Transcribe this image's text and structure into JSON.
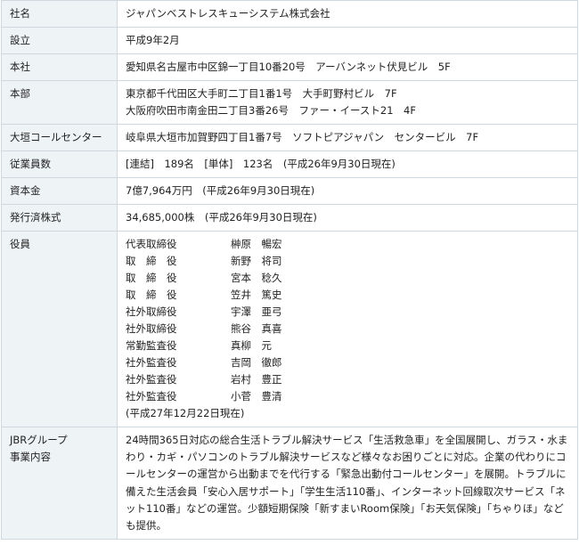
{
  "rows": {
    "company_name": {
      "label": "社名",
      "value": "ジャパンベストレスキューシステム株式会社"
    },
    "established": {
      "label": "設立",
      "value": "平成9年2月"
    },
    "head_office": {
      "label": "本社",
      "value": "愛知県名古屋市中区錦一丁目10番20号　アーバンネット伏見ビル　5F"
    },
    "headquarters": {
      "label": "本部",
      "line1": "東京都千代田区大手町二丁目1番1号　大手町野村ビル　7F",
      "line2": "大阪府吹田市南金田二丁目3番26号　ファー・イースト21　4F"
    },
    "call_center": {
      "label": "大垣コールセンター",
      "value": "岐阜県大垣市加賀野四丁目1番7号　ソフトピアジャパン　センタービル　7F"
    },
    "employees": {
      "label": "従業員数",
      "value": "[連結]　189名　[単体]　123名　(平成26年9月30日現在)"
    },
    "capital": {
      "label": "資本金",
      "value": "7億7,964万円　(平成26年9月30日現在)"
    },
    "shares": {
      "label": "発行済株式",
      "value": "34,685,000株　(平成26年9月30日現在)"
    },
    "officers": {
      "label": "役員",
      "list": [
        {
          "role": "代表取締役",
          "name": "榊原　暢宏"
        },
        {
          "role": "取　締　役",
          "name": "新野　将司"
        },
        {
          "role": "取　締　役",
          "name": "宮本　稔久"
        },
        {
          "role": "取　締　役",
          "name": "笠井　篤史"
        },
        {
          "role": "社外取締役",
          "name": "宇澤　亜弓"
        },
        {
          "role": "社外取締役",
          "name": "熊谷　真喜"
        },
        {
          "role": "常勤監査役",
          "name": "真柳　元"
        },
        {
          "role": "社外監査役",
          "name": "吉岡　徹郎"
        },
        {
          "role": "社外監査役",
          "name": "岩村　豊正"
        },
        {
          "role": "社外監査役",
          "name": "小菅　豊清"
        }
      ],
      "note": "(平成27年12月22日現在)"
    },
    "business": {
      "label_line1": "JBRグループ",
      "label_line2": "事業内容",
      "text": "24時間365日対応の総合生活トラブル解決サービス「生活救急車」を全国展開し、ガラス・水まわり・カギ・パソコンのトラブル解決サービスなど様々なお困りごとに対応。企業の代わりにコールセンターの運営から出動までを代行する「緊急出動付コールセンター」を展開。トラブルに備えた生活会員「安心入居サポート」「学生生活110番」、インターネット回線取次サービス「ネット110番」などの運営。少額短期保険「新すまいRoom保険」「お天気保険」「ちゃりほ」なども提供。"
    }
  }
}
